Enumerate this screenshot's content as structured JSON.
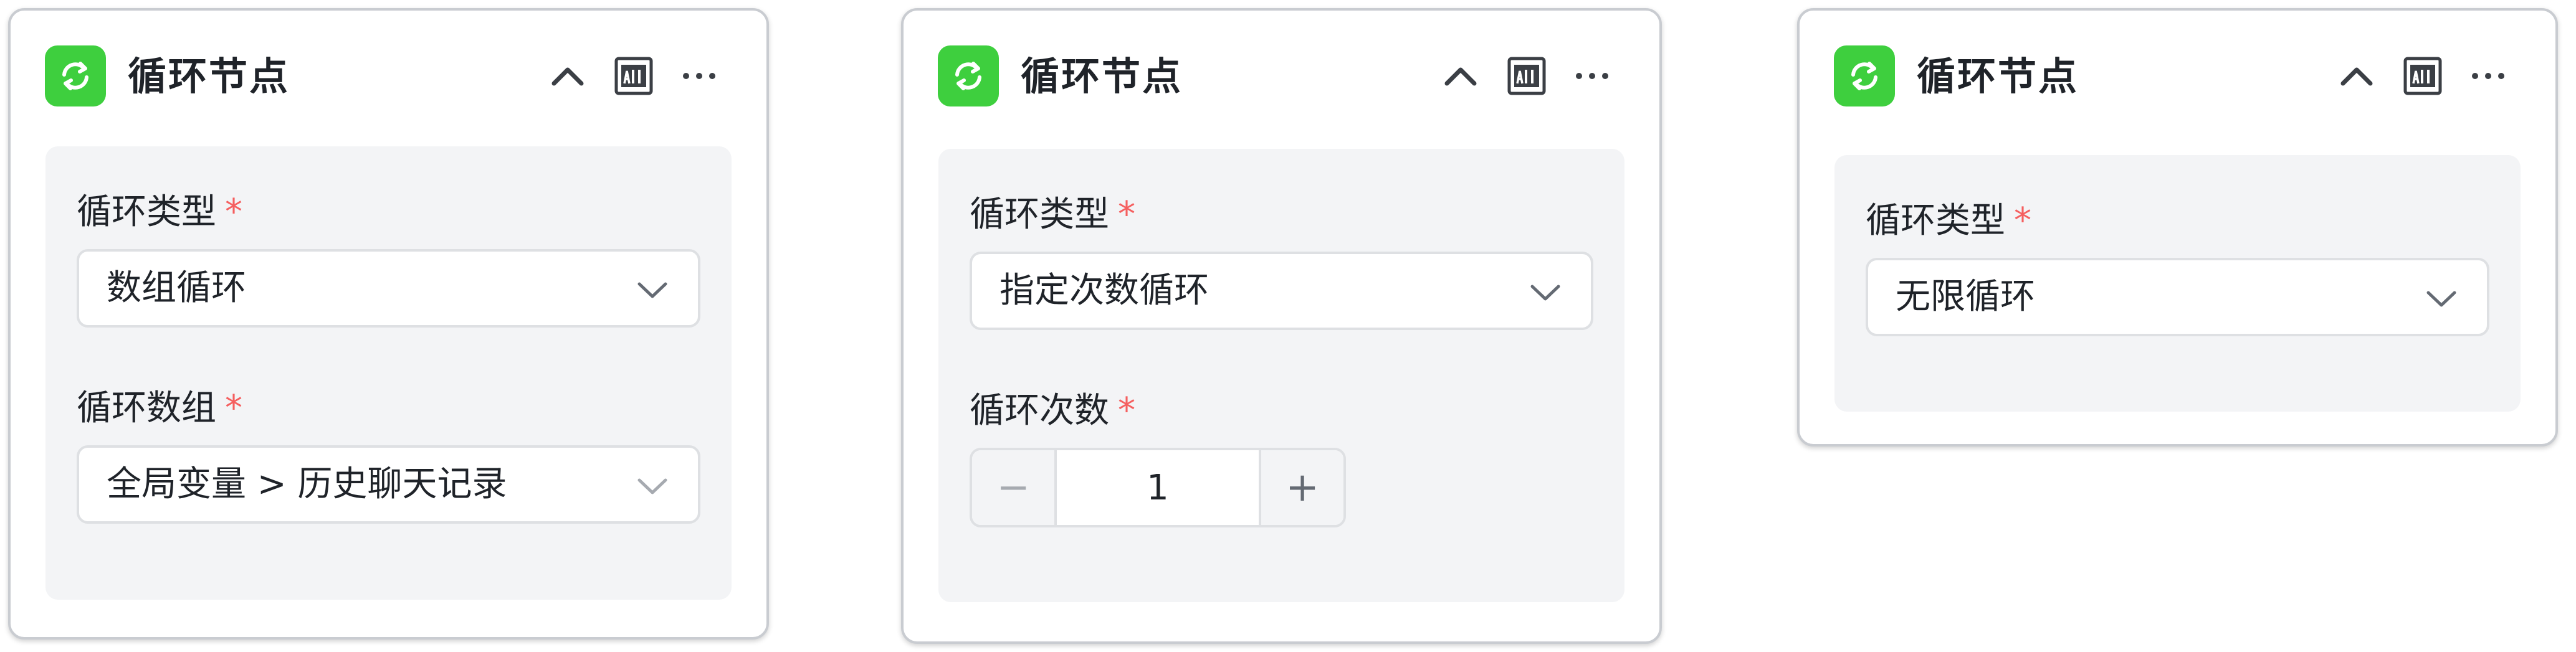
{
  "colors": {
    "accent": "#3ecf3e",
    "required": "#f55f5f",
    "panel_bg": "#f3f4f6",
    "border": "#dee0e3"
  },
  "cards": [
    {
      "title": "循环节点",
      "icons": [
        "loop-icon",
        "chevron-up-icon",
        "all-icon",
        "more-icon"
      ],
      "fields": [
        {
          "label": "循环类型",
          "required": "*",
          "type": "select",
          "value": "数组循环"
        },
        {
          "label": "循环数组",
          "required": "*",
          "type": "select",
          "value": "全局变量 > 历史聊天记录"
        }
      ]
    },
    {
      "title": "循环节点",
      "icons": [
        "loop-icon",
        "chevron-up-icon",
        "all-icon",
        "more-icon"
      ],
      "fields": [
        {
          "label": "循环类型",
          "required": "*",
          "type": "select",
          "value": "指定次数循环"
        },
        {
          "label": "循环次数",
          "required": "*",
          "type": "stepper",
          "value": "1",
          "minus": "−",
          "plus": "+"
        }
      ]
    },
    {
      "title": "循环节点",
      "icons": [
        "loop-icon",
        "chevron-up-icon",
        "all-icon",
        "more-icon"
      ],
      "fields": [
        {
          "label": "循环类型",
          "required": "*",
          "type": "select",
          "value": "无限循环"
        }
      ]
    }
  ]
}
